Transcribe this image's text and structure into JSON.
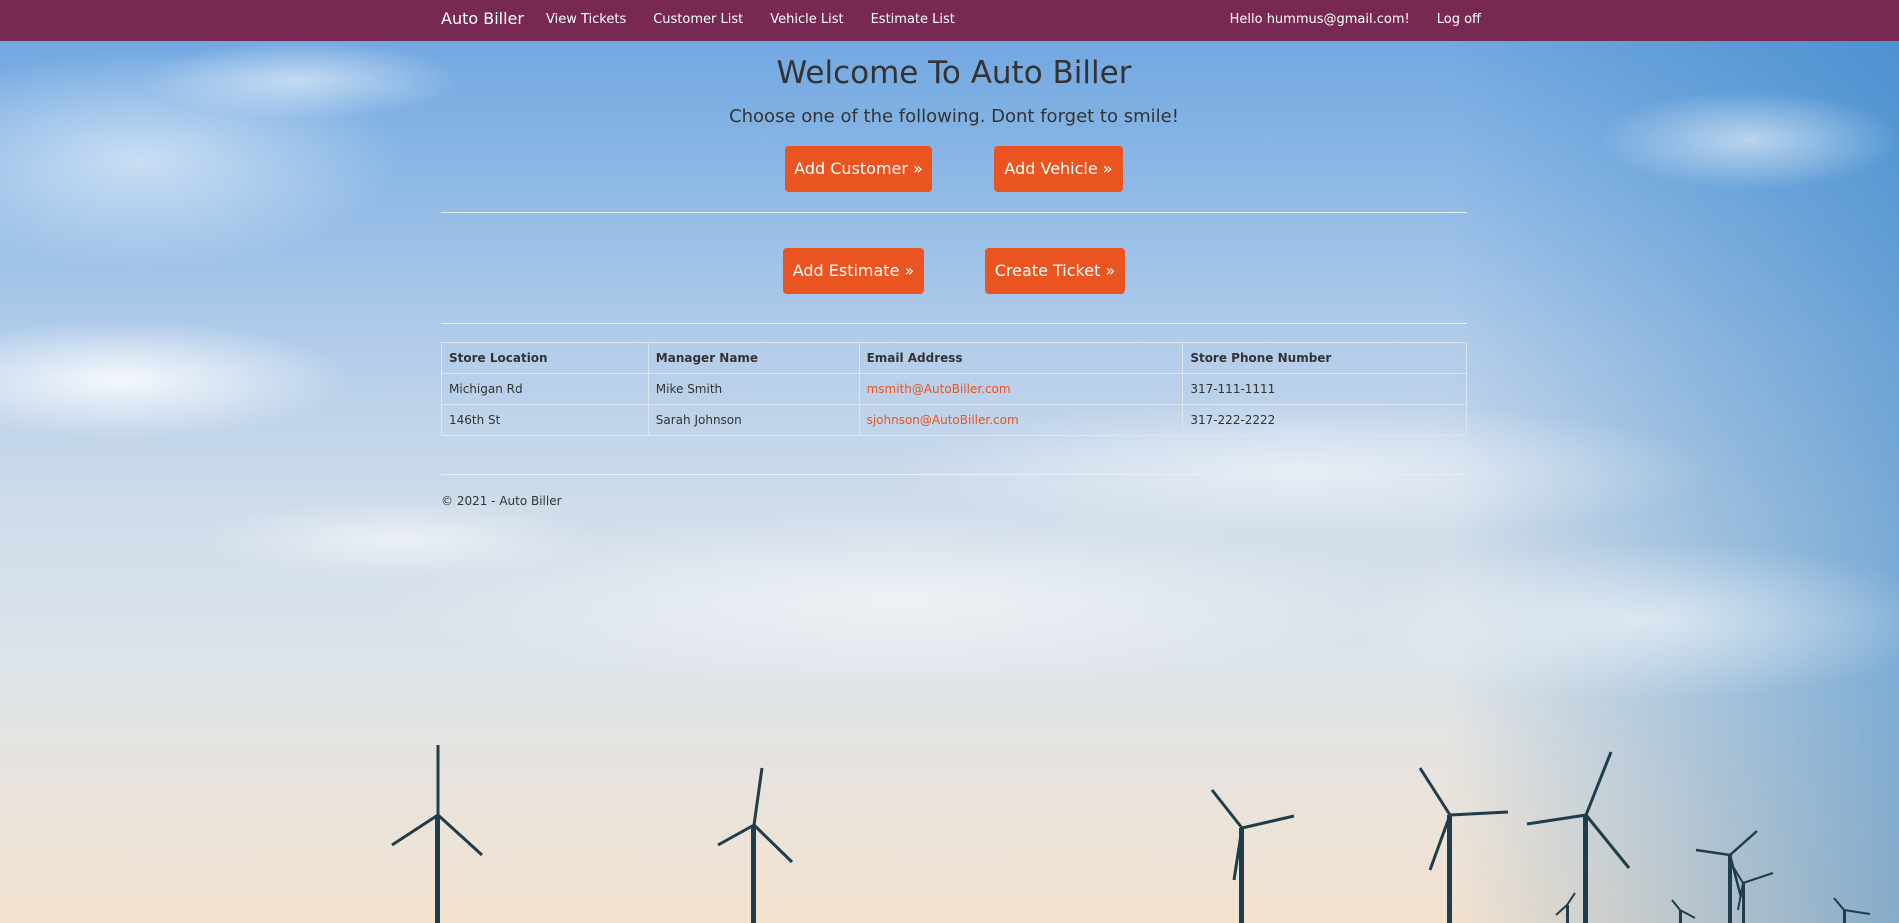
{
  "navbar": {
    "brand": "Auto Biller",
    "links": [
      {
        "label": "View Tickets"
      },
      {
        "label": "Customer List"
      },
      {
        "label": "Vehicle List"
      },
      {
        "label": "Estimate List"
      }
    ],
    "greeting": "Hello hummus@gmail.com!",
    "logoff": "Log off",
    "color": "#772953"
  },
  "hero": {
    "title": "Welcome To Auto Biller",
    "subtitle": "Choose one of the following. Dont forget to smile!"
  },
  "actions": {
    "add_customer": "Add Customer »",
    "add_vehicle": "Add Vehicle »",
    "add_estimate": "Add Estimate »",
    "create_ticket": "Create Ticket »",
    "color": "#e95420"
  },
  "stores_table": {
    "headers": [
      "Store Location",
      "Manager Name",
      "Email Address",
      "Store Phone Number"
    ],
    "rows": [
      {
        "location": "Michigan Rd",
        "manager": "Mike Smith",
        "email": "msmith@AutoBiller.com",
        "phone": "317-111-1111"
      },
      {
        "location": "146th St",
        "manager": "Sarah Johnson",
        "email": "sjohnson@AutoBiller.com",
        "phone": "317-222-2222"
      }
    ]
  },
  "footer": {
    "text": "© 2021 - Auto Biller"
  },
  "icons": [
    "wind-turbine-icon"
  ]
}
